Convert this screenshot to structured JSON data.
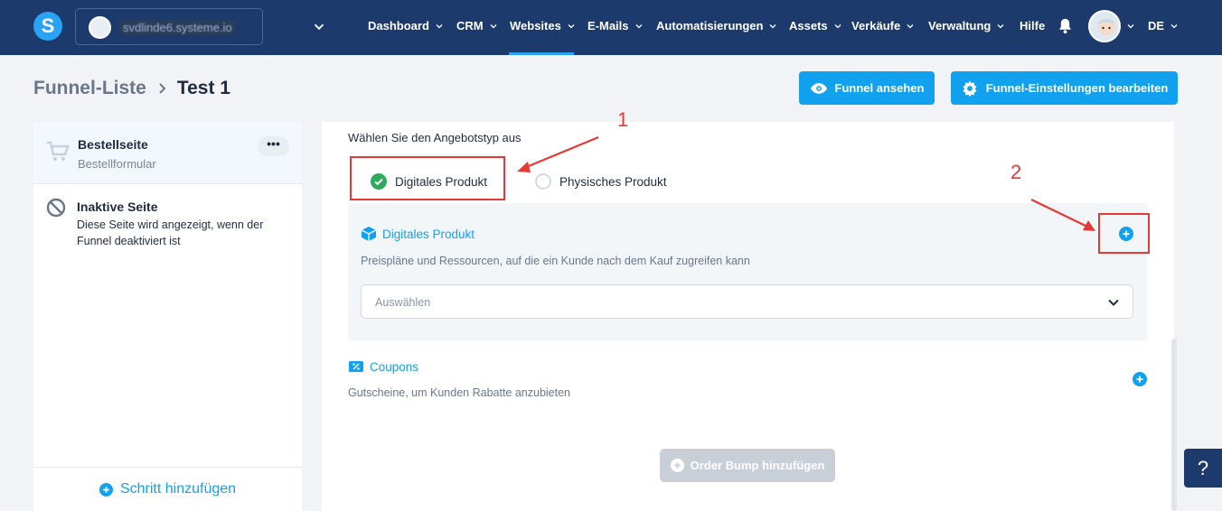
{
  "topbar": {
    "logo_letter": "S",
    "account_name": "svdlinde6.systeme.io",
    "nav": [
      {
        "label": "Dashboard"
      },
      {
        "label": "CRM"
      },
      {
        "label": "Websites"
      },
      {
        "label": "E-Mails"
      },
      {
        "label": "Automatisierungen"
      },
      {
        "label": "Assets"
      },
      {
        "label": "Verkäufe"
      },
      {
        "label": "Verwaltung"
      },
      {
        "label": "Hilfe"
      }
    ],
    "active_nav": "Websites",
    "language": "DE"
  },
  "breadcrumb": {
    "parent": "Funnel-Liste",
    "current": "Test 1"
  },
  "header_buttons": {
    "view_funnel": "Funnel ansehen",
    "edit_settings": "Funnel-Einstellungen bearbeiten"
  },
  "sidebar": {
    "active_step": {
      "title": "Bestellseite",
      "subtitle": "Bestellformular",
      "menu": "•••"
    },
    "inactive_step": {
      "title": "Inaktive Seite",
      "description": "Diese Seite wird angezeigt, wenn der Funnel deaktiviert ist"
    },
    "add_step": "Schritt hinzufügen"
  },
  "main": {
    "offer_type_label": "Wählen Sie den Angebotstyp aus",
    "options": {
      "digital": "Digitales Produkt",
      "physical": "Physisches Produkt"
    },
    "selected_option": "digital",
    "digital_section": {
      "title": "Digitales Produkt",
      "description": "Preispläne und Ressourcen, auf die ein Kunde nach dem Kauf zugreifen kann",
      "select_placeholder": "Auswählen"
    },
    "coupons_section": {
      "title": "Coupons",
      "description": "Gutscheine, um Kunden Rabatte anzubieten"
    },
    "order_bump_button": "Order Bump hinzufügen"
  },
  "annotations": {
    "label_1": "1",
    "label_2": "2",
    "color": "#e53935"
  },
  "help_button": "?",
  "colors": {
    "nav_bg": "#1c3a6b",
    "accent": "#11a1ee",
    "success": "#2eaa5c"
  }
}
